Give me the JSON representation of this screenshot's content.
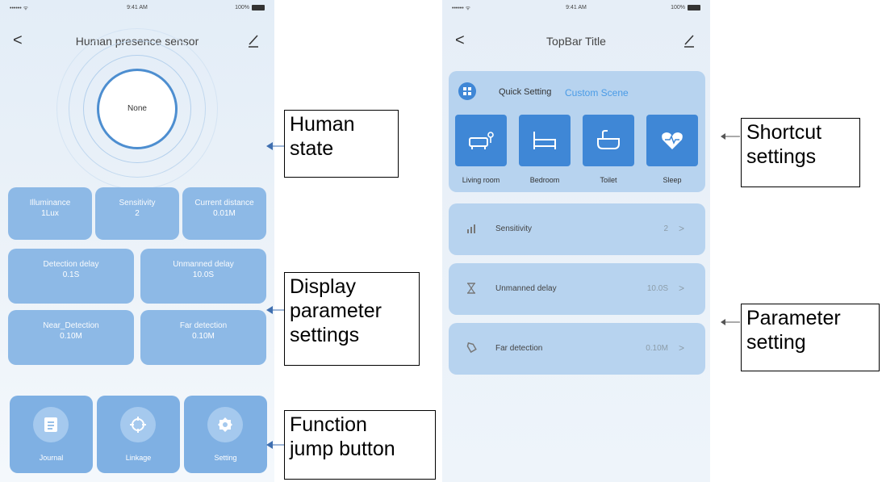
{
  "left_screen": {
    "status": {
      "signal": "•••••• ᯤ",
      "time": "9:41 AM",
      "battery": "100%"
    },
    "topbar": {
      "back": "<",
      "title": "Human presence sensor"
    },
    "human_state": "None",
    "parameters": [
      {
        "label": "Illuminance",
        "value": "1Lux"
      },
      {
        "label": "Sensitivity",
        "value": "2"
      },
      {
        "label": "Current distance",
        "value": "0.01M"
      },
      {
        "label": "Detection delay",
        "value": "0.1S"
      },
      {
        "label": "Unmanned delay",
        "value": "10.0S"
      },
      {
        "label": "Near_Detection",
        "value": "0.10M"
      },
      {
        "label": "Far detection",
        "value": "0.10M"
      }
    ],
    "jump_buttons": [
      {
        "label": "Journal",
        "icon": "document-icon"
      },
      {
        "label": "Linkage",
        "icon": "crosshair-icon"
      },
      {
        "label": "Setting",
        "icon": "gear-icon"
      }
    ]
  },
  "right_screen": {
    "status": {
      "signal": "•••••• ᯤ",
      "time": "9:41 AM",
      "battery": "100%"
    },
    "topbar": {
      "back": "<",
      "title": "TopBar Title"
    },
    "quick_setting": {
      "title": "Quick Setting",
      "custom": "Custom Scene",
      "scenes": [
        {
          "label": "Living room",
          "icon": "sofa-icon"
        },
        {
          "label": "Bedroom",
          "icon": "bed-icon"
        },
        {
          "label": "Toilet",
          "icon": "bathtub-icon"
        },
        {
          "label": "Sleep",
          "icon": "heart-icon"
        }
      ]
    },
    "param_rows": [
      {
        "label": "Sensitivity",
        "value": "2",
        "icon": "bar-chart-icon"
      },
      {
        "label": "Unmanned delay",
        "value": "10.0S",
        "icon": "hourglass-icon"
      },
      {
        "label": "Far detection",
        "value": "0.10M",
        "icon": "tag-icon"
      }
    ],
    "chevron": ">"
  },
  "annotations": {
    "human_state": "Human\nstate",
    "display_params": "Display\nparameter\nsettings",
    "function_jump": "Function\njump button",
    "shortcut": "Shortcut\nsettings",
    "param_setting": "Parameter\nsetting"
  },
  "colors": {
    "tile": "#8db9e6",
    "accent": "#3f87d6",
    "card": "#b7d3ef",
    "custom_link": "#4a9be6"
  }
}
